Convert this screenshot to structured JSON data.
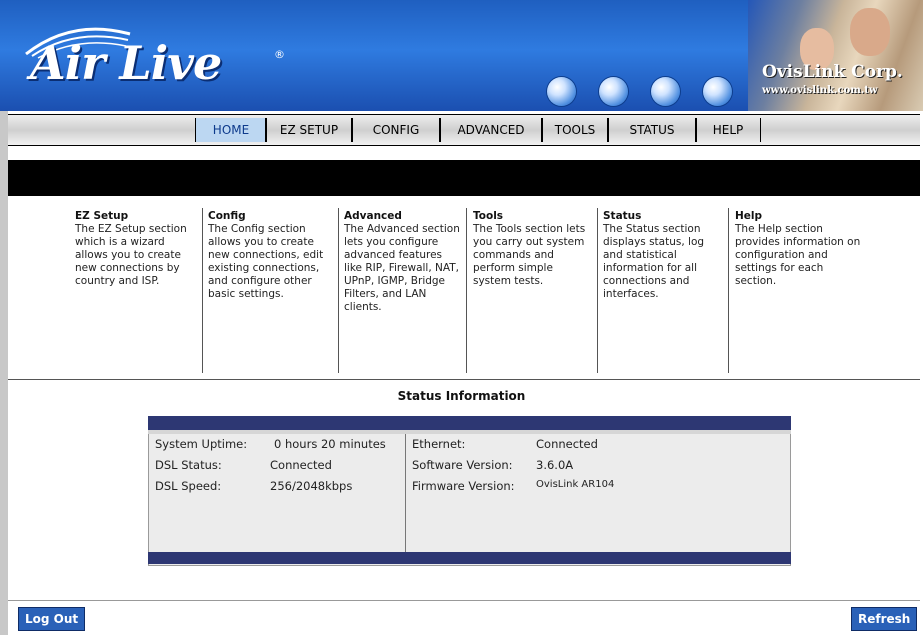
{
  "header": {
    "logo": "Air Live",
    "logo_mark": "®",
    "brand": "OvisLink Corp.",
    "brand_url": "www.ovislink.com.tw",
    "colors": {
      "banner": "#2f7be0",
      "nav_active": "#bcd7f2",
      "status_bar": "#2d3773",
      "button": "#2a61b8"
    }
  },
  "nav": {
    "tabs": [
      {
        "label": "HOME",
        "active": true
      },
      {
        "label": "EZ SETUP",
        "active": false
      },
      {
        "label": "CONFIG",
        "active": false
      },
      {
        "label": "ADVANCED",
        "active": false
      },
      {
        "label": "TOOLS",
        "active": false
      },
      {
        "label": "STATUS",
        "active": false
      },
      {
        "label": "HELP",
        "active": false
      }
    ]
  },
  "help": [
    {
      "title": "EZ Setup",
      "text": "The EZ Setup section which is a wizard allows you to create new connections by country and ISP."
    },
    {
      "title": "Config",
      "text": "The Config section allows you to create new connections, edit existing connections, and configure other basic settings."
    },
    {
      "title": "Advanced",
      "text": "The Advanced section lets you configure advanced features like RIP, Firewall, NAT, UPnP, IGMP, Bridge Filters, and LAN clients."
    },
    {
      "title": "Tools",
      "text": "The Tools section lets you carry out system commands and perform simple system tests."
    },
    {
      "title": "Status",
      "text": "The Status section displays status, log and statistical information for all connections and interfaces."
    },
    {
      "title": "Help",
      "text": "The Help section provides information on configuration and settings for each section."
    }
  ],
  "status": {
    "title": "Status Information",
    "left": [
      {
        "label": "System Uptime:",
        "value": "0 hours 20 minutes"
      },
      {
        "label": "DSL Status:",
        "value": "Connected"
      },
      {
        "label": "DSL Speed:",
        "value": "256/2048kbps"
      }
    ],
    "right": [
      {
        "label": "Ethernet:",
        "value": "Connected"
      },
      {
        "label": "Software Version:",
        "value": "3.6.0A"
      },
      {
        "label": "Firmware Version:",
        "value": "OvisLink AR104"
      }
    ]
  },
  "buttons": {
    "logout": "Log Out",
    "refresh": "Refresh"
  }
}
